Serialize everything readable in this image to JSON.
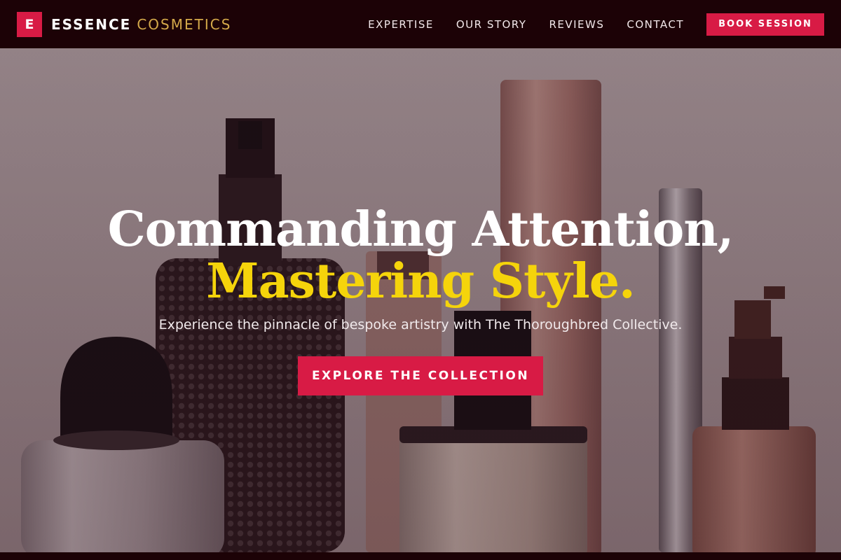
{
  "nav": {
    "logo_letter": "E",
    "brand_primary": "ESSENCE",
    "brand_secondary": "COSMETICS",
    "links": [
      "EXPERTISE",
      "OUR STORY",
      "REVIEWS",
      "CONTACT"
    ],
    "book_label": "BOOK SESSION"
  },
  "hero": {
    "title_line1": "Commanding Attention,",
    "title_line2": "Mastering Style.",
    "subtitle": "Experience the pinnacle of bespoke artistry with The Thoroughbred Collective.",
    "cta_label": "EXPLORE THE COLLECTION"
  },
  "colors": {
    "accent": "#d81b45",
    "highlight": "#f5d40b",
    "nav_bg": "#1c0206",
    "brand_gold": "#d4a94a"
  }
}
